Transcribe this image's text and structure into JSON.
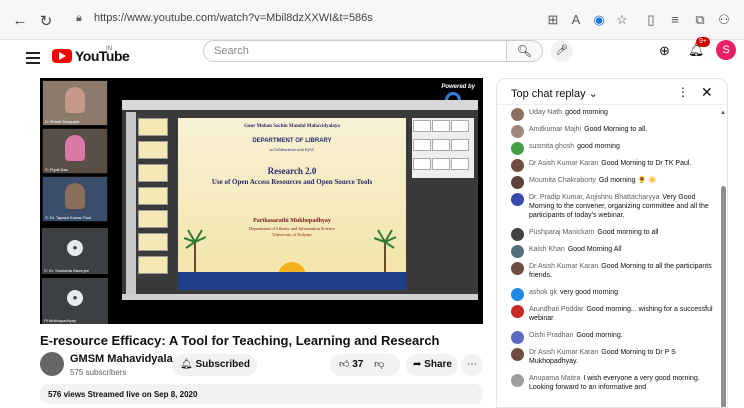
{
  "browser": {
    "url": "https://www.youtube.com/watch?v=Mbil8dzXXWI&t=586s"
  },
  "youtube": {
    "logo_text": "YouTube",
    "logo_sup": "IN",
    "search_placeholder": "Search",
    "notification_count": "9+",
    "avatar_letter": "S"
  },
  "video": {
    "title": "E-resource Efficacy: A Tool for Teaching, Learning and Research",
    "powered_by": "Powered by",
    "participants": [
      {
        "name": "S: Shirali Sengupta"
      },
      {
        "name": "S: Piyali Das"
      },
      {
        "name": "S: Dr. Tapash Kumar Paul"
      },
      {
        "name": "S: Dr. Sushanta Banerjee"
      },
      {
        "name": "PI Mukhopadhyay"
      }
    ],
    "slide": {
      "college": "Gour Mohan Sachin Mandal Mahavidyalaya",
      "department": "DEPARTMENT OF LIBRARY",
      "collab": "in Collaboration with IQAC",
      "topic": "Research 2.0",
      "subtopic": "Use of Open Access Resources and Open Source Tools",
      "speaker": "Parthasarathi Mukhopadhyay",
      "speaker_dept": "Department of Library and Information Science",
      "speaker_univ": "University of Kalyani"
    }
  },
  "channel": {
    "name": "GMSM Mahavidyala...",
    "subscribers": "575 subscribers",
    "subscribed_label": "Subscribed",
    "likes": "37",
    "share_label": "Share"
  },
  "description": {
    "meta": "576 views  Streamed live on Sep 8, 2020"
  },
  "chat": {
    "header": "Top chat replay",
    "messages": [
      {
        "author": "Uday Nath",
        "text": "good morning",
        "color": "#8d6e63"
      },
      {
        "author": "Amitkumar Majhi",
        "text": "Good Morning to all.",
        "color": "#a1887f"
      },
      {
        "author": "susmita ghosh",
        "text": "good morning",
        "color": "#43a047"
      },
      {
        "author": "Dr Asish Kumar Karan",
        "text": "Good Morning to Dr TK Paul.",
        "color": "#6d4c41"
      },
      {
        "author": "Moumita Chakraborty",
        "text": "Gd morning 🌻 ☀️",
        "color": "#5d4037"
      },
      {
        "author": "Dr. Pradip Kumar, Anjishnu Bhattacharyya",
        "text": "Very Good Morning to the convener, organizing committee and all the participants of today's webinar.",
        "color": "#3949ab"
      },
      {
        "author": "Pushparaj Manickam",
        "text": "Good morning to all",
        "color": "#424242"
      },
      {
        "author": "Kaish Khan",
        "text": "Good Morning All",
        "color": "#546e7a"
      },
      {
        "author": "Dr Asish Kumar Karan",
        "text": "Good Morning to all the participants friends.",
        "color": "#6d4c41"
      },
      {
        "author": "ashok gk",
        "text": "very good morning",
        "color": "#1e88e5"
      },
      {
        "author": "Arundhati Poddar",
        "text": "Good morning... wishing for a successful webinar",
        "color": "#c62828"
      },
      {
        "author": "Oishi Pradhan",
        "text": "Good morning.",
        "color": "#5c6bc0"
      },
      {
        "author": "Dr Asish Kumar Karan",
        "text": "Good Morning to Dr P S Mukhopadhyay.",
        "color": "#6d4c41"
      },
      {
        "author": "Anupama Maitra",
        "text": "I wish everyone a very good morning. Looking forward to an informative and",
        "color": "#9e9e9e"
      }
    ]
  }
}
